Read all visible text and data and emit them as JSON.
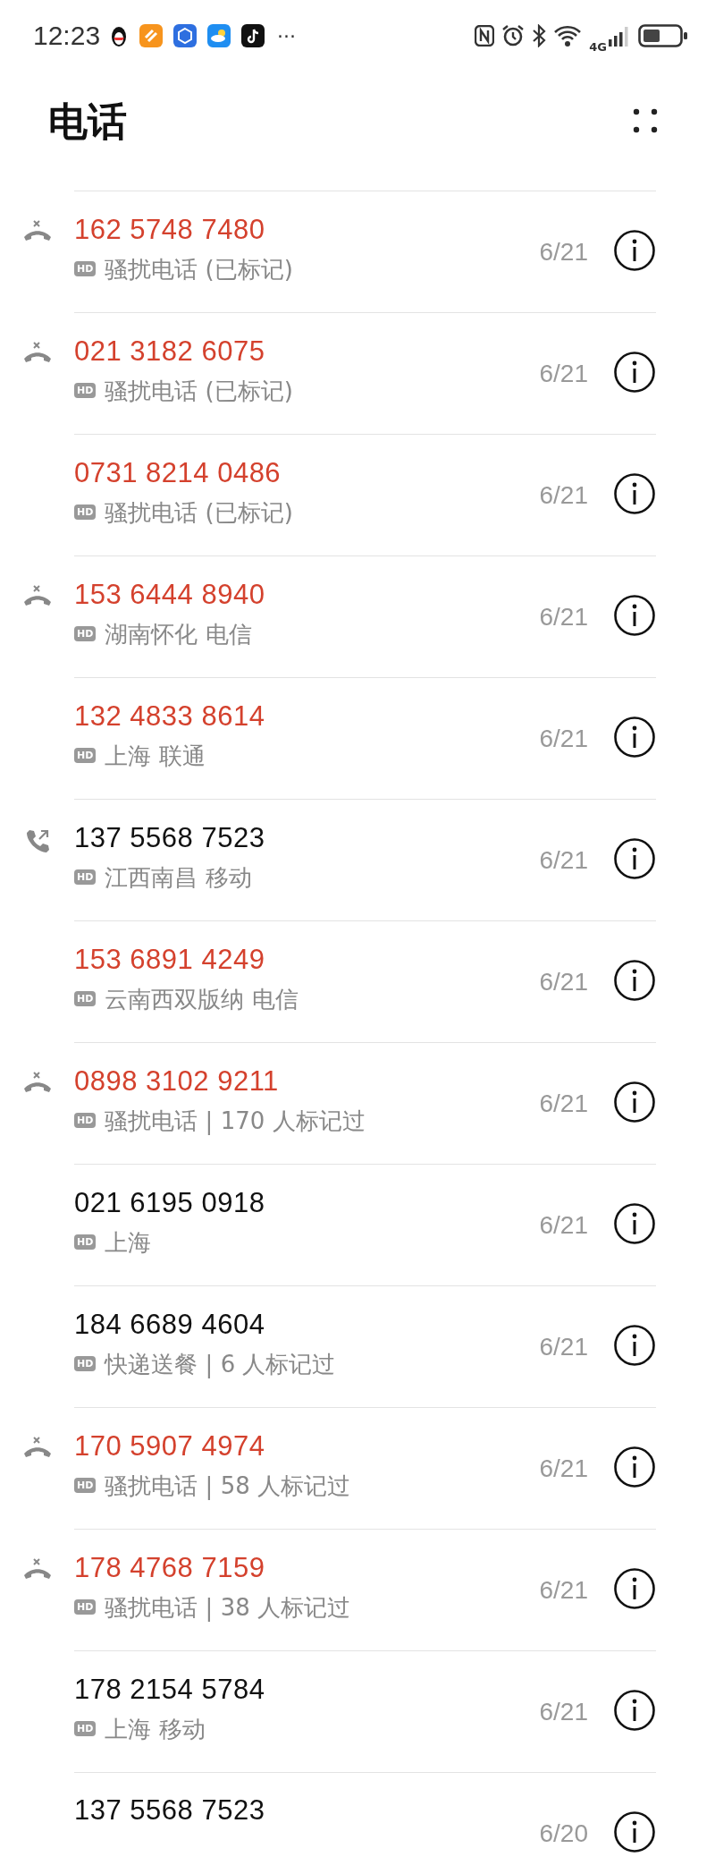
{
  "status_bar": {
    "time": "12:23",
    "more": "···",
    "network": "4G"
  },
  "header": {
    "title": "电话"
  },
  "calls": [
    {
      "number": "162 5748 7480",
      "missed": true,
      "kind": "rejected",
      "badge": "HD",
      "detail": "骚扰电话 (已标记)",
      "date": "6/21"
    },
    {
      "number": "021 3182 6075",
      "missed": true,
      "kind": "rejected",
      "badge": "HD",
      "detail": "骚扰电话 (已标记)",
      "date": "6/21"
    },
    {
      "number": "0731 8214 0486",
      "missed": true,
      "badge": "HD",
      "detail": "骚扰电话 (已标记)",
      "date": "6/21"
    },
    {
      "number": "153 6444 8940",
      "missed": true,
      "kind": "rejected",
      "badge": "HD",
      "detail": "湖南怀化 电信",
      "date": "6/21"
    },
    {
      "number": "132 4833 8614",
      "missed": true,
      "badge": "HD",
      "detail": "上海 联通",
      "date": "6/21"
    },
    {
      "number": "137 5568 7523",
      "missed": false,
      "kind": "outgoing",
      "badge": "HD",
      "detail": "江西南昌 移动",
      "date": "6/21"
    },
    {
      "number": "153 6891 4249",
      "missed": true,
      "badge": "HD",
      "detail": "云南西双版纳 电信",
      "date": "6/21"
    },
    {
      "number": "0898 3102 9211",
      "missed": true,
      "kind": "rejected",
      "badge": "HD",
      "detail": "骚扰电话 | 170 人标记过",
      "date": "6/21"
    },
    {
      "number": "021 6195 0918",
      "missed": false,
      "badge": "HD",
      "detail": "上海",
      "date": "6/21"
    },
    {
      "number": "184 6689 4604",
      "missed": false,
      "badge": "HD",
      "detail": "快递送餐 | 6 人标记过",
      "date": "6/21"
    },
    {
      "number": "170 5907 4974",
      "missed": true,
      "kind": "rejected",
      "badge": "HD",
      "detail": "骚扰电话 | 58 人标记过",
      "date": "6/21"
    },
    {
      "number": "178 4768 7159",
      "missed": true,
      "kind": "rejected",
      "badge": "HD",
      "detail": "骚扰电话 | 38 人标记过",
      "date": "6/21"
    },
    {
      "number": "178 2154 5784",
      "missed": false,
      "badge": "HD",
      "detail": "上海 移动",
      "date": "6/21"
    },
    {
      "number": "137 5568 7523",
      "missed": false,
      "date": "6/20"
    }
  ]
}
